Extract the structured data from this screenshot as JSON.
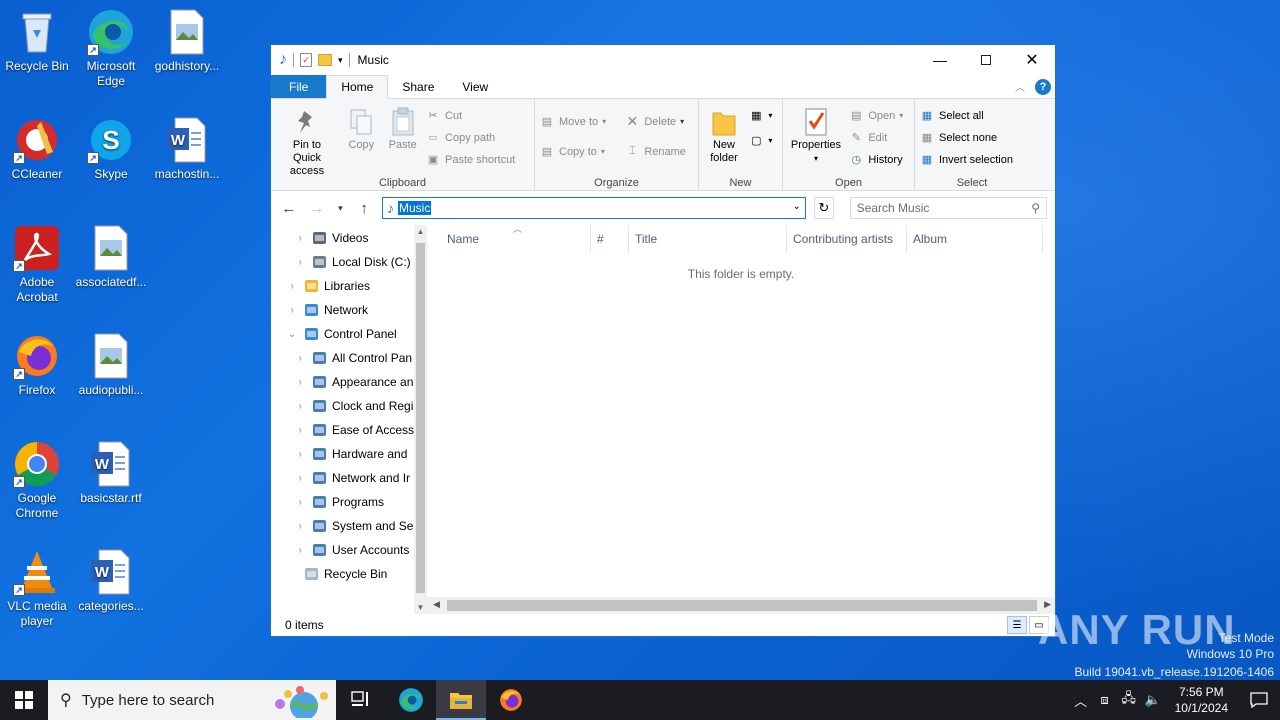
{
  "desktop": {
    "icons": [
      {
        "label": "Recycle Bin",
        "icon": "recycle-bin-icon"
      },
      {
        "label": "Microsoft Edge",
        "icon": "edge-icon"
      },
      {
        "label": "godhistory...",
        "icon": "image-file-icon"
      },
      {
        "label": "CCleaner",
        "icon": "ccleaner-icon"
      },
      {
        "label": "Skype",
        "icon": "skype-icon"
      },
      {
        "label": "machostin...",
        "icon": "word-doc-icon"
      },
      {
        "label": "Adobe Acrobat",
        "icon": "acrobat-icon"
      },
      {
        "label": "associatedf...",
        "icon": "image-file-icon"
      },
      {
        "label": "Firefox",
        "icon": "firefox-icon"
      },
      {
        "label": "audiopubli...",
        "icon": "image-file-icon"
      },
      {
        "label": "Google Chrome",
        "icon": "chrome-icon"
      },
      {
        "label": "basicstar.rtf",
        "icon": "word-doc-icon"
      },
      {
        "label": "VLC media player",
        "icon": "vlc-icon"
      },
      {
        "label": "categories...",
        "icon": "word-doc-icon"
      }
    ]
  },
  "explorer": {
    "title": "Music",
    "tabs": {
      "file": "File",
      "home": "Home",
      "share": "Share",
      "view": "View"
    },
    "ribbon": {
      "clipboard": {
        "name": "Clipboard",
        "pin": "Pin to Quick access",
        "copy": "Copy",
        "paste": "Paste",
        "cut": "Cut",
        "copy_path": "Copy path",
        "paste_shortcut": "Paste shortcut"
      },
      "organize": {
        "name": "Organize",
        "move_to": "Move to",
        "copy_to": "Copy to",
        "delete": "Delete",
        "rename": "Rename"
      },
      "new": {
        "name": "New",
        "new_folder": "New folder"
      },
      "open": {
        "name": "Open",
        "properties": "Properties",
        "open": "Open",
        "edit": "Edit",
        "history": "History"
      },
      "select": {
        "name": "Select",
        "select_all": "Select all",
        "select_none": "Select none",
        "invert": "Invert selection"
      }
    },
    "address": "Music",
    "search_placeholder": "Search Music",
    "nav": [
      {
        "label": "Videos",
        "indent": 2
      },
      {
        "label": "Local Disk (C:)",
        "indent": 2
      },
      {
        "label": "Libraries",
        "indent": 1
      },
      {
        "label": "Network",
        "indent": 1
      },
      {
        "label": "Control Panel",
        "indent": 1
      },
      {
        "label": "All Control Pan",
        "indent": 2
      },
      {
        "label": "Appearance an",
        "indent": 2
      },
      {
        "label": "Clock and Regi",
        "indent": 2
      },
      {
        "label": "Ease of Access",
        "indent": 2
      },
      {
        "label": "Hardware and",
        "indent": 2
      },
      {
        "label": "Network and Ir",
        "indent": 2
      },
      {
        "label": "Programs",
        "indent": 2
      },
      {
        "label": "System and Se",
        "indent": 2
      },
      {
        "label": "User Accounts",
        "indent": 2
      },
      {
        "label": "Recycle Bin",
        "indent": 1
      }
    ],
    "columns": [
      "Name",
      "#",
      "Title",
      "Contributing artists",
      "Album"
    ],
    "empty_message": "This folder is empty.",
    "status": "0 items"
  },
  "watermark": {
    "brand": "ANY RUN",
    "line1": "Test Mode",
    "line2": "Windows 10 Pro",
    "line3": "Build 19041.vb_release.191206-1406"
  },
  "taskbar": {
    "search_placeholder": "Type here to search",
    "time": "7:56 PM",
    "date": "10/1/2024"
  }
}
